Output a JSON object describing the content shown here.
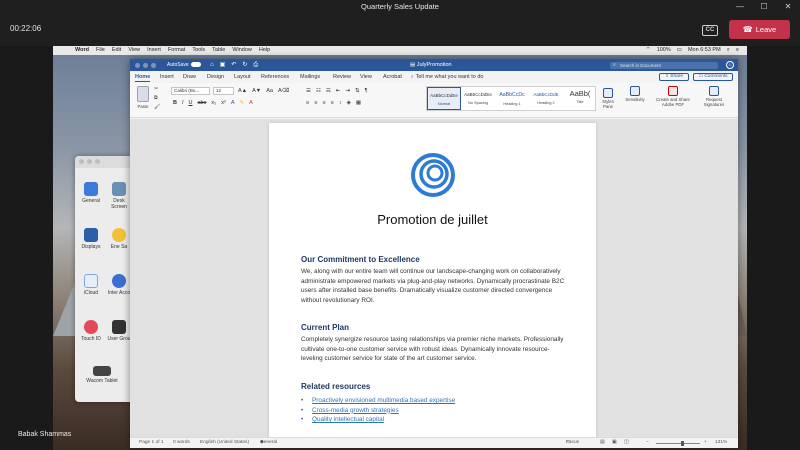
{
  "window": {
    "title": "Quarterly Sales Update",
    "controls": [
      "—",
      "☐",
      "✕"
    ]
  },
  "meeting": {
    "timer": "00:22:06",
    "cc_label": "CC",
    "leave_label": "Leave",
    "participant_name": "Babak Shammas"
  },
  "mac_menubar": {
    "items": [
      "Word",
      "File",
      "Edit",
      "View",
      "Insert",
      "Format",
      "Tools",
      "Table",
      "Window",
      "Help"
    ],
    "battery": "100%",
    "clock": "Mon 6:53 PM"
  },
  "prefs": {
    "items": [
      {
        "label": "General",
        "color": "#3b7bd9"
      },
      {
        "label": "Desk Screen",
        "color": "#6a8fb5"
      },
      {
        "label": "Displays",
        "color": "#2d5fa8"
      },
      {
        "label": "Ene Sa",
        "color": "#f0c238"
      },
      {
        "label": "iCloud",
        "color": "#e6eef9"
      },
      {
        "label": "Inter Acco",
        "color": "#3a6fd1"
      },
      {
        "label": "Touch ID",
        "color": "#e24a5a"
      },
      {
        "label": "User Grou",
        "color": "#333333"
      },
      {
        "label": "Wacom Tablet",
        "color": "#444444"
      }
    ]
  },
  "word": {
    "autosave": "AutoSave",
    "autosave_state": "OFF",
    "document_name": "JulyPromotion",
    "search_placeholder": "Search in Document",
    "tabs": [
      "Home",
      "Insert",
      "Draw",
      "Design",
      "Layout",
      "References",
      "Mailings",
      "Review",
      "View",
      "Acrobat"
    ],
    "tell_me": "Tell me what you want to do",
    "share": "Share",
    "comments": "Comments",
    "ribbon": {
      "paste": "Paste",
      "font": "Calibri (Bo...",
      "size": "12",
      "styles": [
        {
          "sample": "AaBbCcDdEe",
          "name": "Normal"
        },
        {
          "sample": "AaBbCcDdEe",
          "name": "No Spacing"
        },
        {
          "sample": "AaBbCcDc",
          "name": "Heading 1"
        },
        {
          "sample": "AaBbCcDdE",
          "name": "Heading 2"
        },
        {
          "sample": "AaBb(",
          "name": "Title"
        }
      ],
      "styles_pane": "Styles Pane",
      "sensitivity": "Sensitivity",
      "create_share_pdf": "Create and Share Adobe PDF",
      "request_signatures": "Request Signatures"
    },
    "document": {
      "title": "Promotion de juillet",
      "section1_heading": "Our Commitment to Excellence",
      "section1_body": "We, along with our entire team will continue our landscape-changing work on collaboratively administrate empowered markets via plug-and-play networks. Dynamically procrastinate B2C users after installed base benefits. Dramatically visualize customer directed convergence without revolutionary ROI.",
      "section2_heading": "Current Plan",
      "section2_body": "Completely synergize resource taxing relationships via premier niche markets. Professionally cultivate one-to-one customer service with robust ideas. Dynamically innovate resource-leveling customer service for state of the art customer service.",
      "section3_heading": "Related resources",
      "links": [
        "Proactively envisioned multimedia based expertise",
        "Cross-media growth strategies",
        "Quality intellectual capital"
      ]
    },
    "status": {
      "page": "Page 1 of 1",
      "words": "0 words",
      "language": "English (United States)",
      "sensitivity": "General",
      "focus": "Focus",
      "zoom": "131%"
    }
  }
}
